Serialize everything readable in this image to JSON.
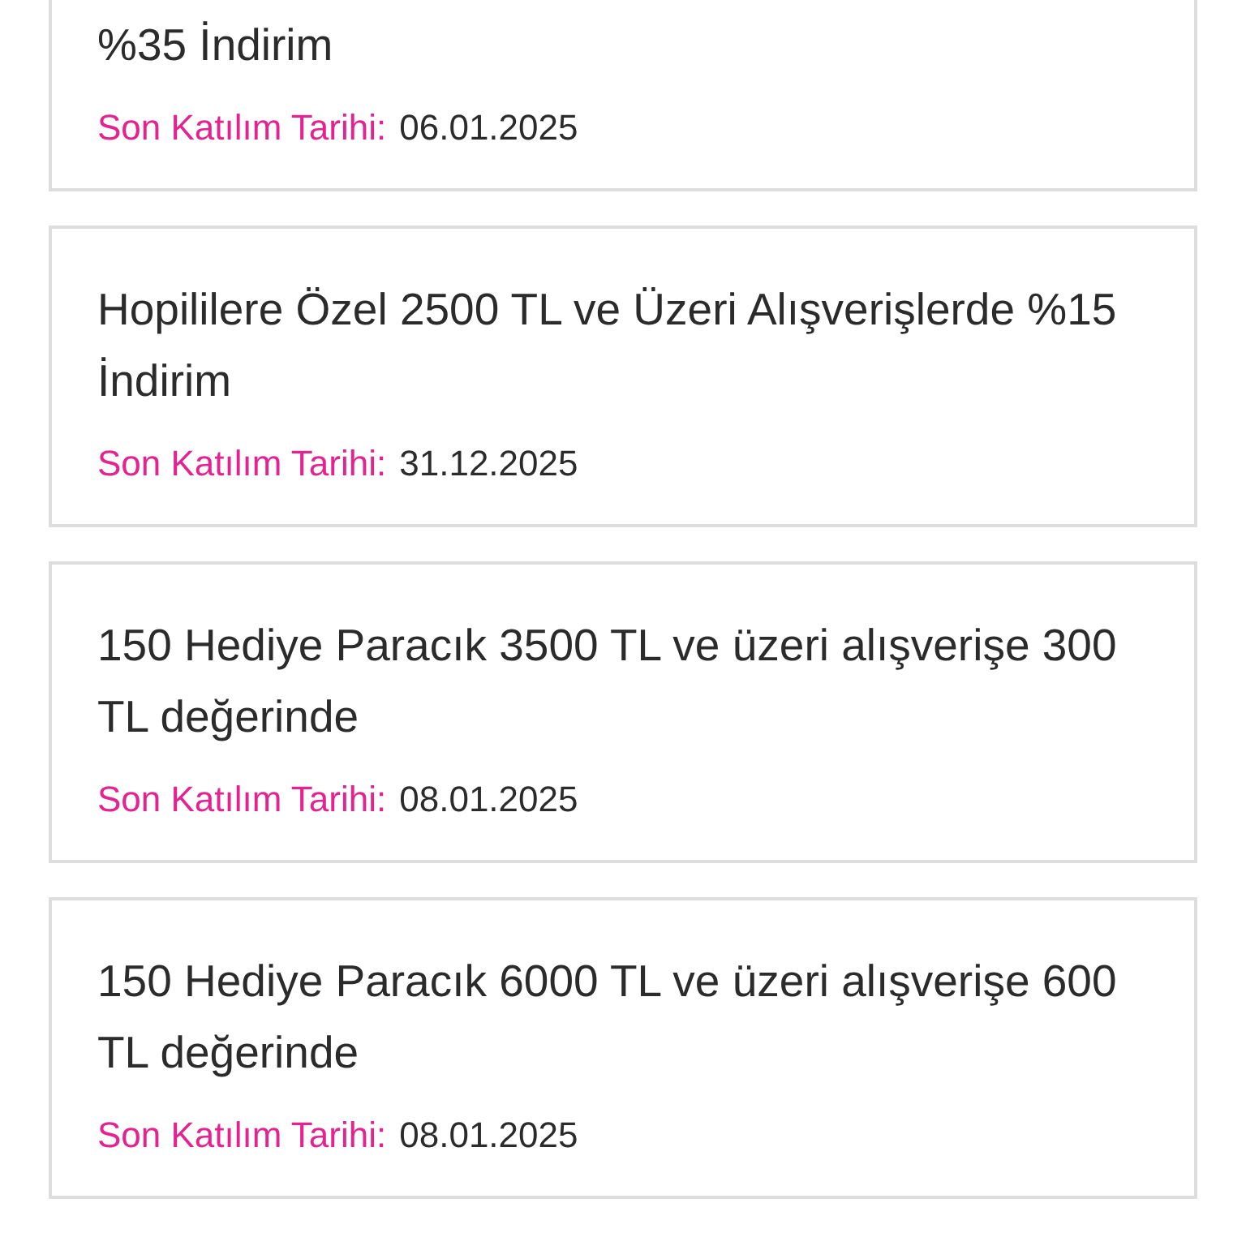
{
  "campaigns": [
    {
      "title": "%35 İndirim",
      "deadline_label": "Son Katılım Tarihi:",
      "deadline": "06.01.2025"
    },
    {
      "title": "Hopililere Özel 2500 TL ve Üzeri Alışverişlerde %15 İndirim",
      "deadline_label": "Son Katılım Tarihi:",
      "deadline": "31.12.2025"
    },
    {
      "title": "150 Hediye Paracık 3500 TL ve üzeri alışverişe 300 TL değerinde",
      "deadline_label": "Son Katılım Tarihi:",
      "deadline": "08.01.2025"
    },
    {
      "title": "150 Hediye Paracık 6000 TL ve üzeri alışverişe 600 TL değerinde",
      "deadline_label": "Son Katılım Tarihi:",
      "deadline": "08.01.2025"
    }
  ]
}
